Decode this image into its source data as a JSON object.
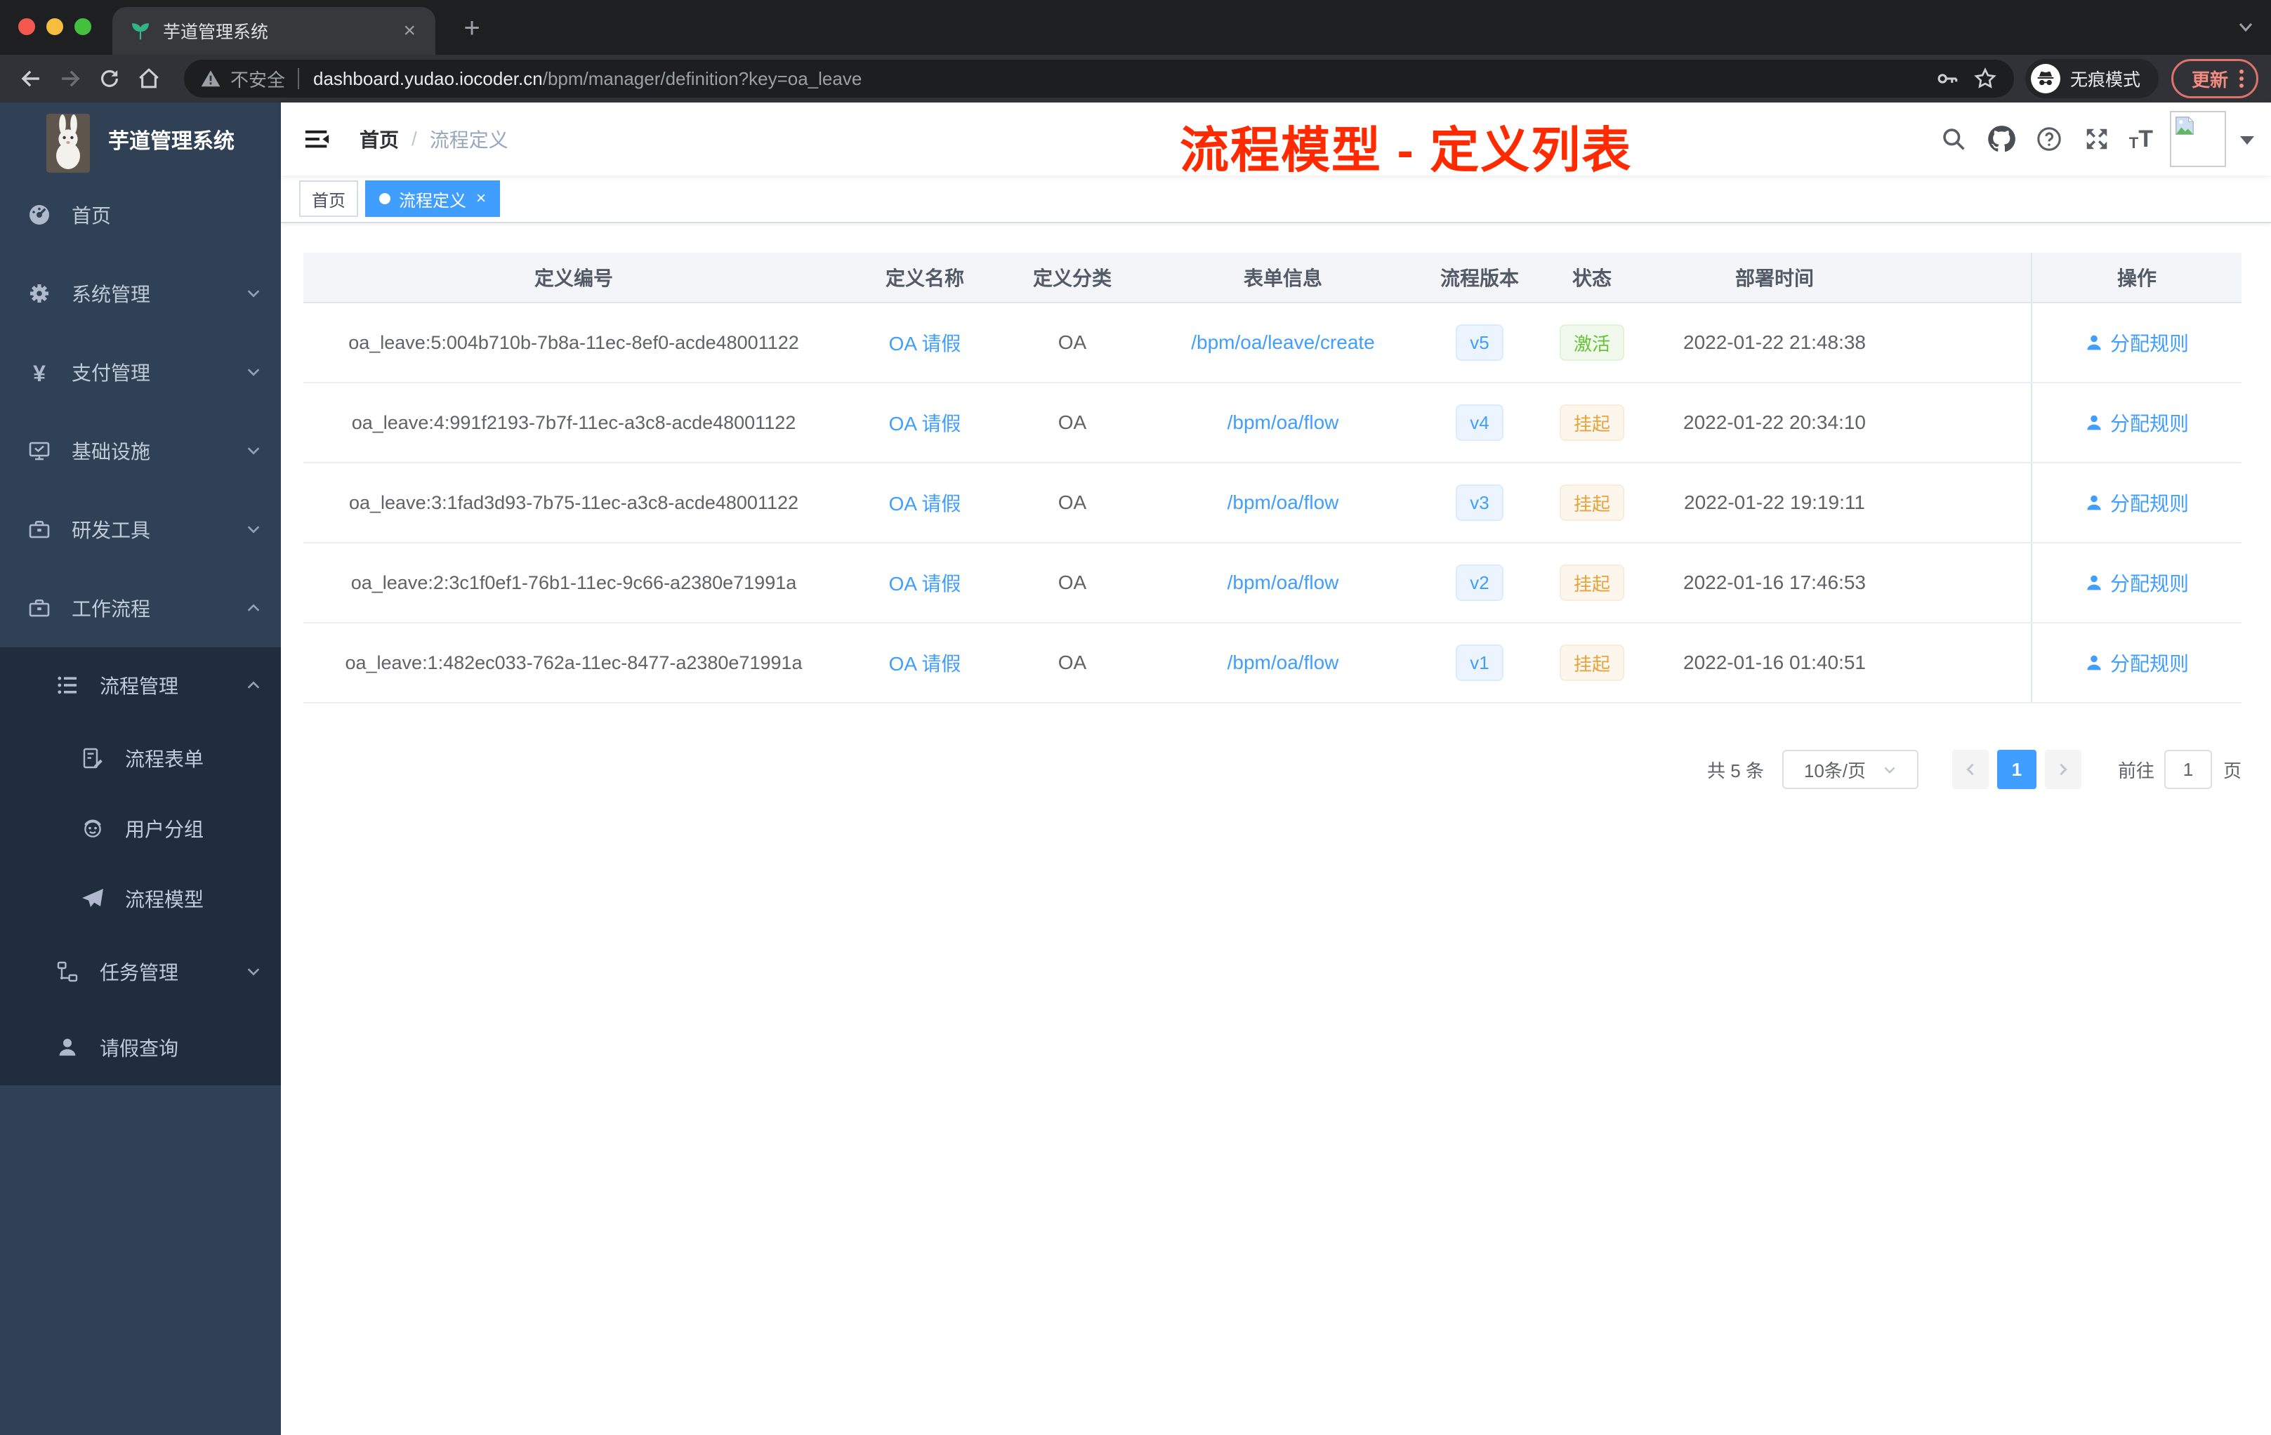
{
  "browser": {
    "tab_title": "芋道管理系统",
    "new_tab_glyph": "+",
    "close_glyph": "×",
    "security_label": "不安全",
    "url_host": "dashboard.yudao.iocoder.cn",
    "url_path": "/bpm/manager/definition?key=oa_leave",
    "incognito_label": "无痕模式",
    "update_label": "更新",
    "icons": [
      "back-arrow",
      "forward-arrow",
      "reload",
      "home",
      "warning-triangle",
      "key",
      "star",
      "incognito",
      "tab-search-chevron"
    ]
  },
  "sidebar": {
    "app_title": "芋道管理系统",
    "items": [
      {
        "label": "首页",
        "icon": "dashboard-icon"
      },
      {
        "label": "系统管理",
        "icon": "gear-icon",
        "chevron": "down"
      },
      {
        "label": "支付管理",
        "icon": "yen-icon",
        "chevron": "down"
      },
      {
        "label": "基础设施",
        "icon": "monitor-icon",
        "chevron": "down"
      },
      {
        "label": "研发工具",
        "icon": "toolbox-icon",
        "chevron": "down"
      },
      {
        "label": "工作流程",
        "icon": "briefcase-icon",
        "chevron": "up"
      }
    ],
    "submenu": {
      "items": [
        {
          "label": "流程管理",
          "icon": "list-icon",
          "chevron": "up",
          "level": 2
        },
        {
          "label": "流程表单",
          "icon": "form-icon",
          "level": 3
        },
        {
          "label": "用户分组",
          "icon": "group-icon",
          "level": 3
        },
        {
          "label": "流程模型",
          "icon": "paper-plane-icon",
          "level": 3
        },
        {
          "label": "任务管理",
          "icon": "tree-icon",
          "chevron": "down",
          "level": 2
        },
        {
          "label": "请假查询",
          "icon": "person-icon",
          "level": 2
        }
      ]
    }
  },
  "header": {
    "breadcrumb": {
      "root": "首页",
      "separator": "/",
      "current": "流程定义"
    },
    "right_icons": [
      "search-icon",
      "github-icon",
      "help-icon",
      "fullscreen-icon",
      "font-size-icon",
      "avatar",
      "caret-down"
    ]
  },
  "annotation": {
    "text": "流程模型 - 定义列表",
    "color": "#ff2a00"
  },
  "tags": {
    "inactive": "首页",
    "active": "流程定义",
    "close_glyph": "×"
  },
  "table": {
    "columns": [
      "定义编号",
      "定义名称",
      "定义分类",
      "表单信息",
      "流程版本",
      "状态",
      "部署时间",
      "操作"
    ],
    "rows": [
      {
        "id": "oa_leave:5:004b710b-7b8a-11ec-8ef0-acde48001122",
        "name": "OA 请假",
        "category": "OA",
        "form": "/bpm/oa/leave/create",
        "version": "v5",
        "status": "激活",
        "status_type": "success",
        "deploy_time": "2022-01-22 21:48:38",
        "action": "分配规则"
      },
      {
        "id": "oa_leave:4:991f2193-7b7f-11ec-a3c8-acde48001122",
        "name": "OA 请假",
        "category": "OA",
        "form": "/bpm/oa/flow",
        "version": "v4",
        "status": "挂起",
        "status_type": "warning",
        "deploy_time": "2022-01-22 20:34:10",
        "action": "分配规则"
      },
      {
        "id": "oa_leave:3:1fad3d93-7b75-11ec-a3c8-acde48001122",
        "name": "OA 请假",
        "category": "OA",
        "form": "/bpm/oa/flow",
        "version": "v3",
        "status": "挂起",
        "status_type": "warning",
        "deploy_time": "2022-01-22 19:19:11",
        "action": "分配规则"
      },
      {
        "id": "oa_leave:2:3c1f0ef1-76b1-11ec-9c66-a2380e71991a",
        "name": "OA 请假",
        "category": "OA",
        "form": "/bpm/oa/flow",
        "version": "v2",
        "status": "挂起",
        "status_type": "warning",
        "deploy_time": "2022-01-16 17:46:53",
        "action": "分配规则"
      },
      {
        "id": "oa_leave:1:482ec033-762a-11ec-8477-a2380e71991a",
        "name": "OA 请假",
        "category": "OA",
        "form": "/bpm/oa/flow",
        "version": "v1",
        "status": "挂起",
        "status_type": "warning",
        "deploy_time": "2022-01-16 01:40:51",
        "action": "分配规则"
      }
    ],
    "colors": {
      "link": "#409eff",
      "success": "#67c23a",
      "warning": "#e6a23c",
      "version": "#409eff"
    }
  },
  "pagination": {
    "total_label": "共 5 条",
    "page_size": "10条/页",
    "current_page": "1",
    "goto_label": "前往",
    "goto_value": "1",
    "page_unit": "页"
  }
}
